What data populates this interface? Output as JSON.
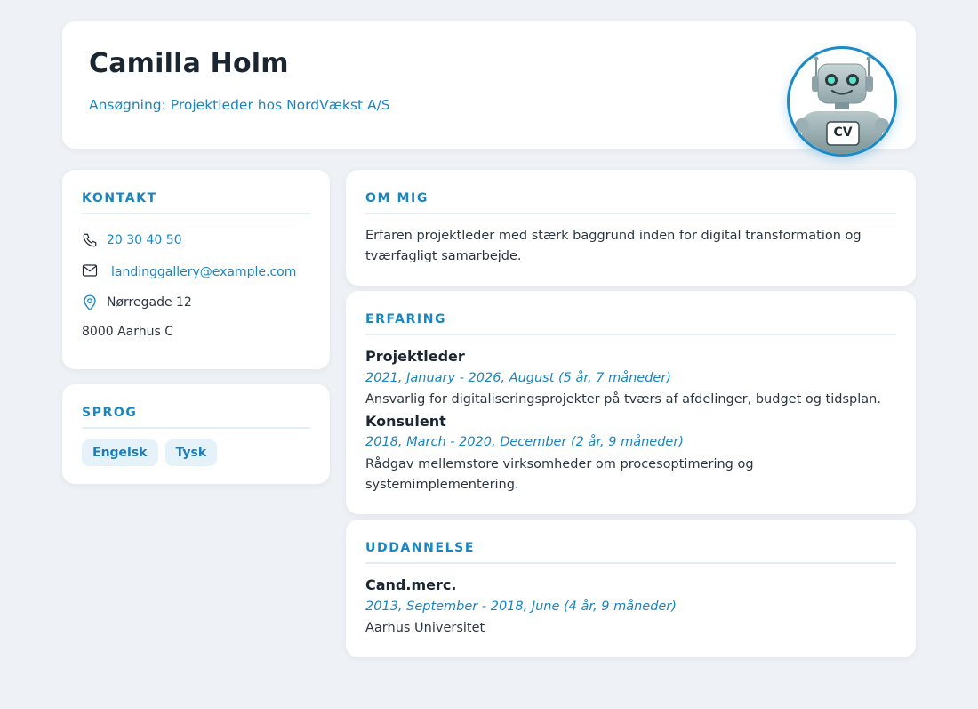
{
  "header": {
    "name": "Camilla Holm",
    "subtitle": "Ansøgning: Projektleder hos NordVækst A/S",
    "avatar_badge": "CV"
  },
  "contact": {
    "title": "KONTAKT",
    "phone": "20 30 40 50",
    "email": "landinggallery@example.com",
    "address_line1": "Nørregade 12",
    "address_line2": "8000 Aarhus C"
  },
  "languages": {
    "title": "SPROG",
    "items": [
      "Engelsk",
      "Tysk"
    ]
  },
  "about": {
    "title": "OM MIG",
    "text": "Erfaren projektleder med stærk baggrund inden for digital transformation og tværfagligt samarbejde."
  },
  "experience": {
    "title": "ERFARING",
    "items": [
      {
        "title": "Projektleder",
        "period": "2021, January - 2026, August (5 år, 7 måneder)",
        "description": "Ansvarlig for digitaliseringsprojekter på tværs af afdelinger, budget og tidsplan."
      },
      {
        "title": "Konsulent",
        "period": "2018, March - 2020, December (2 år, 9 måneder)",
        "description": "Rådgav mellemstore virksomheder om procesoptimering og systemimplementering."
      }
    ]
  },
  "education": {
    "title": "UDDANNELSE",
    "items": [
      {
        "degree": "Cand.merc.",
        "period": "2013, September - 2018, June (4 år, 9 måneder)",
        "institution": "Aarhus Universitet"
      }
    ]
  },
  "colors": {
    "accent": "#1a85c1",
    "background": "#eef2f6",
    "card": "#ffffff",
    "chip_bg": "#e6f2fa"
  },
  "icons": {
    "phone": "phone-icon",
    "email": "mail-icon",
    "address": "location-pin-icon"
  }
}
